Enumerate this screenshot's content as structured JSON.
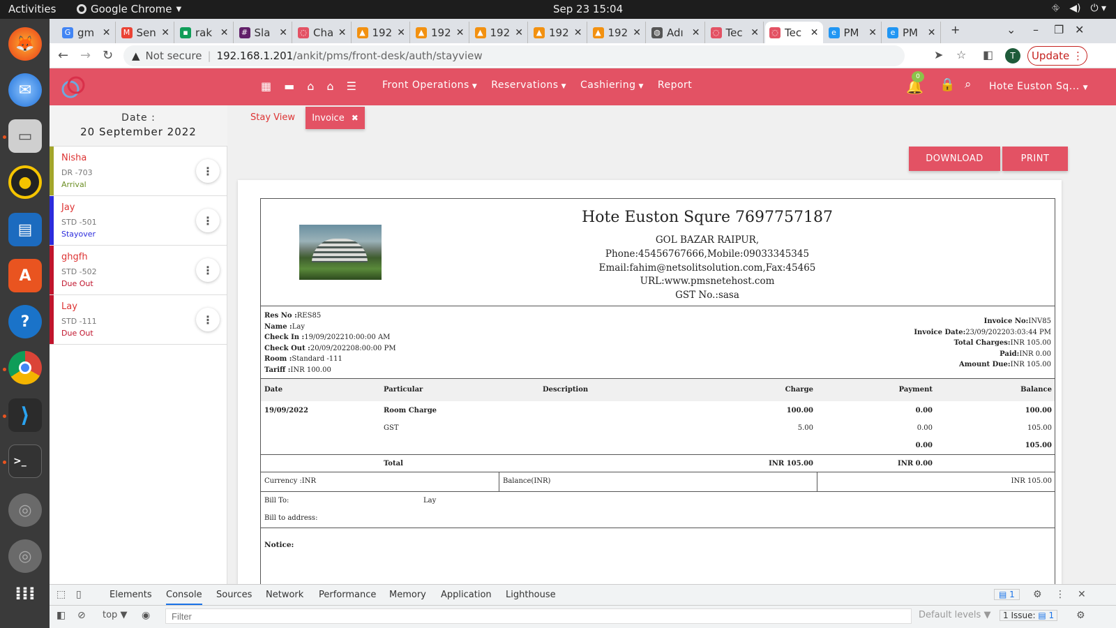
{
  "os": {
    "activities": "Activities",
    "app_name": "Google Chrome",
    "clock": "Sep 23  15:04"
  },
  "browser": {
    "tabs": [
      {
        "label": "gm",
        "color": "#4285f4",
        "glyph": "G"
      },
      {
        "label": "Sen",
        "color": "#ea4335",
        "glyph": "M"
      },
      {
        "label": "rak",
        "color": "#0f9d58",
        "glyph": "▪"
      },
      {
        "label": "Sla",
        "color": "#611f69",
        "glyph": "#"
      },
      {
        "label": "Cha",
        "color": "#e35264",
        "glyph": "◌"
      },
      {
        "label": "192",
        "color": "#f29111",
        "glyph": "▲"
      },
      {
        "label": "192",
        "color": "#f29111",
        "glyph": "▲"
      },
      {
        "label": "192",
        "color": "#f29111",
        "glyph": "▲"
      },
      {
        "label": "192",
        "color": "#f29111",
        "glyph": "▲"
      },
      {
        "label": "192",
        "color": "#f29111",
        "glyph": "▲"
      },
      {
        "label": "Adı",
        "color": "#555555",
        "glyph": "◍"
      },
      {
        "label": "Tec",
        "color": "#e35264",
        "glyph": "◌"
      },
      {
        "label": "Tec",
        "color": "#e35264",
        "glyph": "◌"
      },
      {
        "label": "PM",
        "color": "#2196f3",
        "glyph": "e"
      },
      {
        "label": "PM",
        "color": "#2196f3",
        "glyph": "e"
      }
    ],
    "url_not_secure": "Not secure",
    "url_host": "192.168.1.201",
    "url_path": "/ankit/pms/front-desk/auth/stayview",
    "profile_initial": "T",
    "update_label": "Update"
  },
  "app": {
    "menu": [
      "Front Operations",
      "Reservations",
      "Cashiering",
      "Report"
    ],
    "notification_count": "0",
    "hotel_selector": "Hote Euston Sq..."
  },
  "sidebar": {
    "date_label": "Date :",
    "date_value": "20 September 2022",
    "guests": [
      {
        "name": "Nisha",
        "room": "DR -703",
        "status": "Arrival",
        "bar_color": "#a3a52a",
        "status_color": "#6b8e23"
      },
      {
        "name": "Jay",
        "room": "STD -501",
        "status": "Stayover",
        "bar_color": "#2b2bdc",
        "status_color": "#2b2bdc"
      },
      {
        "name": "ghgfh",
        "room": "STD -502",
        "status": "Due Out",
        "bar_color": "#c0142c",
        "status_color": "#c0142c"
      },
      {
        "name": "Lay",
        "room": "STD -111",
        "status": "Due Out",
        "bar_color": "#c0142c",
        "status_color": "#c0142c"
      }
    ]
  },
  "tabs": {
    "stay_view": "Stay View",
    "invoice": "Invoice",
    "close_glyph": "✖"
  },
  "actions": {
    "download": "DOWNLOAD",
    "print": "PRINT"
  },
  "invoice": {
    "hotel_title": "Hote Euston Squre 7697757187",
    "address": "GOL BAZAR RAIPUR,",
    "phone": "Phone:45456767666,Mobile:09033345345",
    "email": "Email:fahim@netsolitsolution.com,Fax:45465",
    "url": "URL:www.pmsnetehost.com",
    "gst": "GST No.:sasa",
    "res_no_label": "Res No :",
    "res_no": "RES85",
    "name_label": "Name :",
    "name": "Lay",
    "checkin_label": "Check In :",
    "checkin": "19/09/202210:00:00 AM",
    "checkout_label": "Check Out :",
    "checkout": "20/09/202208:00:00 PM",
    "room_label": "Room :",
    "room": "Standard -111",
    "tariff_label": "Tariff :",
    "tariff": "INR 100.00",
    "invoice_no_label": "Invoice No:",
    "invoice_no": "INV85",
    "invoice_date_label": "Invoice Date:",
    "invoice_date": "23/09/202203:03:44 PM",
    "total_charges_label": "Total Charges:",
    "total_charges": "INR 105.00",
    "paid_label": "Paid:",
    "paid": "INR 0.00",
    "amount_due_label": "Amount Due:",
    "amount_due": "INR 105.00",
    "columns": {
      "date": "Date",
      "particular": "Particular",
      "description": "Description",
      "charge": "Charge",
      "payment": "Payment",
      "balance": "Balance"
    },
    "rows": [
      {
        "date": "19/09/2022",
        "particular": "Room Charge",
        "charge": "100.00",
        "payment": "0.00",
        "balance": "100.00"
      },
      {
        "date": "",
        "particular": "GST",
        "charge": "5.00",
        "payment": "0.00",
        "balance": "105.00"
      },
      {
        "date": "",
        "particular": "",
        "charge": "",
        "payment": "0.00",
        "balance": "105.00"
      }
    ],
    "total_label": "Total",
    "total_charge": "INR 105.00",
    "total_payment": "INR 0.00",
    "currency": "Currency :INR",
    "balance_label": "Balance(INR)",
    "balance_value": "INR 105.00",
    "bill_to_label": "Bill To:",
    "bill_to": "Lay",
    "bill_address_label": "Bill to address:",
    "notice_label": "Notice:"
  },
  "devtools": {
    "tabs": [
      "Elements",
      "Console",
      "Sources",
      "Network",
      "Performance",
      "Memory",
      "Application",
      "Lighthouse"
    ],
    "active_tab": "Console",
    "message_count": "1",
    "context": "top",
    "filter_placeholder": "Filter",
    "levels": "Default levels",
    "issues": "1 Issue:",
    "issues_count": "1"
  }
}
